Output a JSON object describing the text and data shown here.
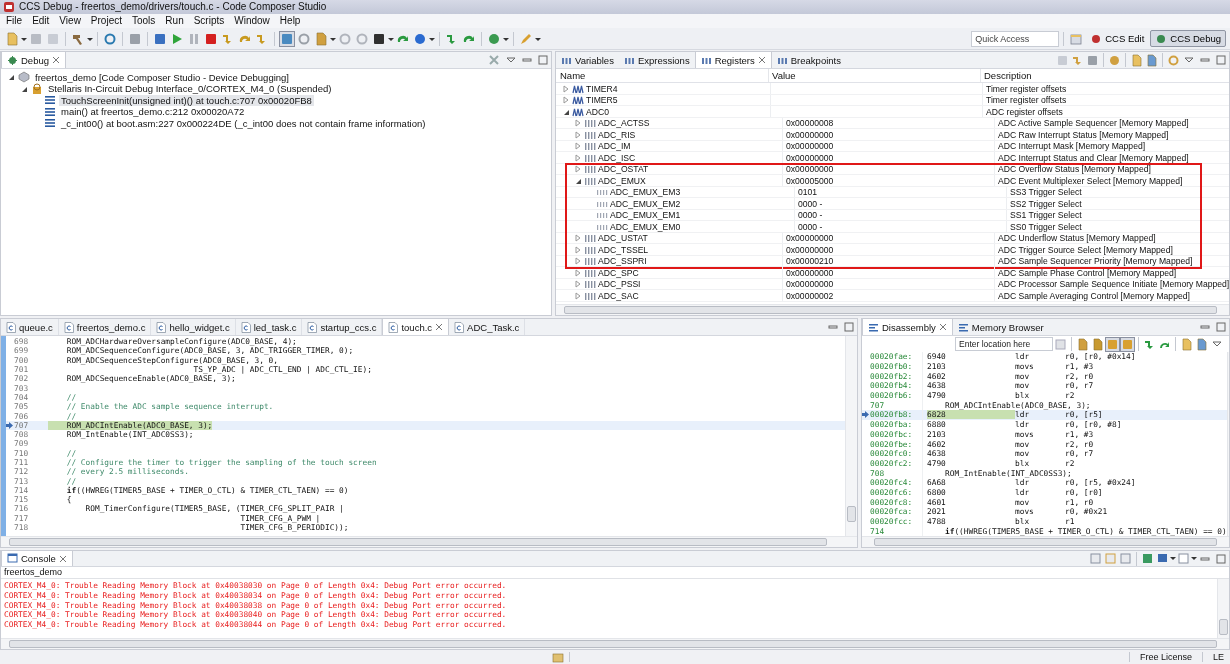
{
  "window": {
    "title": "CCS Debug - freertos_demo/drivers/touch.c - Code Composer Studio"
  },
  "menu": [
    "File",
    "Edit",
    "View",
    "Project",
    "Tools",
    "Run",
    "Scripts",
    "Window",
    "Help"
  ],
  "quick_access": {
    "placeholder": "Quick Access"
  },
  "perspectives": [
    {
      "label": "CCS Edit",
      "selected": false
    },
    {
      "label": "CCS Debug",
      "selected": true
    }
  ],
  "debug": {
    "tabs": [
      {
        "label": "Debug",
        "selected": true
      }
    ],
    "tree": [
      {
        "label": "freertos_demo [Code Composer Studio - Device Debugging]",
        "kind": "launch",
        "expanded": true,
        "children": [
          {
            "label": "Stellaris In-Circuit Debug Interface_0/CORTEX_M4_0 (Suspended)",
            "kind": "target",
            "expanded": true,
            "children": [
              {
                "label": "TouchScreenInit(unsigned int)() at touch.c:707 0x00020FB8",
                "kind": "frame",
                "selected": true
              },
              {
                "label": "main() at freertos_demo.c:212 0x00020A72",
                "kind": "frame",
                "selected": false
              },
              {
                "label": "_c_int00() at boot.asm:227 0x000224DE  (_c_int00 does not contain frame information)",
                "kind": "frame",
                "selected": false
              }
            ]
          }
        ]
      }
    ]
  },
  "registers": {
    "tabs": [
      {
        "label": "Variables",
        "selected": false
      },
      {
        "label": "Expressions",
        "selected": false
      },
      {
        "label": "Registers",
        "selected": true
      },
      {
        "label": "Breakpoints",
        "selected": false
      }
    ],
    "columns": [
      "Name",
      "Value",
      "Description"
    ],
    "rows": [
      {
        "name": "TIMER4",
        "kind": "group",
        "expanded": false,
        "value": "",
        "description": "Timer register offsets",
        "highlighted": false
      },
      {
        "name": "TIMER5",
        "kind": "group",
        "expanded": false,
        "value": "",
        "description": "Timer register offsets",
        "highlighted": false
      },
      {
        "name": "ADC0",
        "kind": "group",
        "expanded": true,
        "value": "",
        "description": "ADC register offsets",
        "highlighted": false,
        "children": [
          {
            "name": "ADC_ACTSS",
            "kind": "register",
            "expanded": false,
            "value": "0x00000008",
            "description": "ADC Active Sample Sequencer [Memory Mapped]",
            "highlighted": false
          },
          {
            "name": "ADC_RIS",
            "kind": "register",
            "expanded": false,
            "value": "0x00000000",
            "description": "ADC Raw Interrupt Status [Memory Mapped]",
            "highlighted": false
          },
          {
            "name": "ADC_IM",
            "kind": "register",
            "expanded": false,
            "value": "0x00000000",
            "description": "ADC Interrupt Mask [Memory Mapped]",
            "highlighted": false
          },
          {
            "name": "ADC_ISC",
            "kind": "register",
            "expanded": false,
            "value": "0x00000000",
            "description": "ADC Interrupt Status and Clear [Memory Mapped]",
            "highlighted": false
          },
          {
            "name": "ADC_OSTAT",
            "kind": "register",
            "expanded": false,
            "value": "0x00000000",
            "description": "ADC Overflow Status [Memory Mapped]",
            "highlighted": true
          },
          {
            "name": "ADC_EMUX",
            "kind": "register",
            "expanded": true,
            "value": "0x00005000",
            "description": "ADC Event Multiplexer Select [Memory Mapped]",
            "highlighted": true,
            "children": [
              {
                "name": "ADC_EMUX_EM3",
                "kind": "field",
                "value": "0101",
                "description": "SS3 Trigger Select",
                "highlighted": true
              },
              {
                "name": "ADC_EMUX_EM2",
                "kind": "field",
                "value": "0000 -",
                "description": "SS2 Trigger Select",
                "highlighted": true
              },
              {
                "name": "ADC_EMUX_EM1",
                "kind": "field",
                "value": "0000 -",
                "description": "SS1 Trigger Select",
                "highlighted": true
              },
              {
                "name": "ADC_EMUX_EM0",
                "kind": "field",
                "value": "0000 -",
                "description": "SS0 Trigger Select",
                "highlighted": true
              }
            ]
          },
          {
            "name": "ADC_USTAT",
            "kind": "register",
            "expanded": false,
            "value": "0x00000000",
            "description": "ADC Underflow Status [Memory Mapped]",
            "highlighted": true
          },
          {
            "name": "ADC_TSSEL",
            "kind": "register",
            "expanded": false,
            "value": "0x00000000",
            "description": "ADC Trigger Source Select [Memory Mapped]",
            "highlighted": true
          },
          {
            "name": "ADC_SSPRI",
            "kind": "register",
            "expanded": false,
            "value": "0x00000210",
            "description": "ADC Sample Sequencer Priority [Memory Mapped]",
            "highlighted": true
          },
          {
            "name": "ADC_SPC",
            "kind": "register",
            "expanded": false,
            "value": "0x00000000",
            "description": "ADC Sample Phase Control [Memory Mapped]",
            "highlighted": false
          },
          {
            "name": "ADC_PSSI",
            "kind": "register",
            "expanded": false,
            "value": "0x00000000",
            "description": "ADC Processor Sample Sequence Initiate [Memory Mapped]",
            "highlighted": false
          },
          {
            "name": "ADC_SAC",
            "kind": "register",
            "expanded": false,
            "value": "0x00000002",
            "description": "ADC Sample Averaging Control [Memory Mapped]",
            "highlighted": false
          }
        ]
      }
    ]
  },
  "editor": {
    "tabs": [
      {
        "label": "queue.c",
        "selected": false
      },
      {
        "label": "freertos_demo.c",
        "selected": false
      },
      {
        "label": "hello_widget.c",
        "selected": false
      },
      {
        "label": "led_task.c",
        "selected": false
      },
      {
        "label": "startup_ccs.c",
        "selected": false
      },
      {
        "label": "touch.c",
        "selected": true
      },
      {
        "label": "ADC_Task.c",
        "selected": false
      }
    ],
    "lines": [
      {
        "number": "698",
        "kind": "code",
        "current": false,
        "text": "    ROM_ADCHardwareOversampleConfigure(ADC0_BASE, 4);"
      },
      {
        "number": "699",
        "kind": "code",
        "current": false,
        "text": "    ROM_ADCSequenceConfigure(ADC0_BASE, 3, ADC_TRIGGER_TIMER, 0);"
      },
      {
        "number": "700",
        "kind": "code",
        "current": false,
        "text": "    ROM_ADCSequenceStepConfigure(ADC0_BASE, 3, 0,"
      },
      {
        "number": "701",
        "kind": "code",
        "current": false,
        "text": "                               TS_YP_ADC | ADC_CTL_END | ADC_CTL_IE);"
      },
      {
        "number": "702",
        "kind": "code",
        "current": false,
        "text": "    ROM_ADCSequenceEnable(ADC0_BASE, 3);"
      },
      {
        "number": "703",
        "kind": "code",
        "current": false
      },
      {
        "number": "704",
        "kind": "comment",
        "current": false,
        "text": "    //"
      },
      {
        "number": "705",
        "kind": "comment",
        "current": false,
        "text": "    // Enable the ADC sample sequence interrupt."
      },
      {
        "number": "706",
        "kind": "comment",
        "current": false,
        "text": "    //"
      },
      {
        "number": "707",
        "kind": "code",
        "current": true,
        "text": "    ROM_ADCIntEnable(ADC0_BASE, 3);"
      },
      {
        "number": "708",
        "kind": "code",
        "current": false,
        "text": "    ROM_IntEnable(INT_ADC0SS3);"
      },
      {
        "number": "709",
        "kind": "code",
        "current": false
      },
      {
        "number": "710",
        "kind": "comment",
        "current": false,
        "text": "    //"
      },
      {
        "number": "711",
        "kind": "comment",
        "current": false,
        "text": "    // Configure the timer to trigger the sampling of the touch screen"
      },
      {
        "number": "712",
        "kind": "comment",
        "current": false,
        "text": "    // every 2.5 milliseconds."
      },
      {
        "number": "713",
        "kind": "comment",
        "current": false,
        "text": "    //"
      },
      {
        "number": "714",
        "kind": "code",
        "current": false,
        "text": "    **if**((HWREG(TIMER5_BASE + TIMER_O_CTL) & TIMER_CTL_TAEN) == 0)"
      },
      {
        "number": "715",
        "kind": "code",
        "current": false,
        "text": "    {"
      },
      {
        "number": "716",
        "kind": "code",
        "current": false,
        "text": "        ROM_TimerConfigure(TIMER5_BASE, (TIMER_CFG_SPLIT_PAIR |"
      },
      {
        "number": "717",
        "kind": "code",
        "current": false,
        "text": "                                         TIMER_CFG_A_PWM |"
      },
      {
        "number": "718",
        "kind": "code",
        "current": false,
        "text": "                                         TIMER_CFG_B_PERIODIC));"
      }
    ]
  },
  "disassembly": {
    "tabs": [
      {
        "label": "Disassembly",
        "selected": true
      },
      {
        "label": "Memory Browser",
        "selected": false
      }
    ],
    "location": {
      "placeholder": "Enter location here"
    },
    "rows": [
      {
        "kind": "instruction",
        "current": false,
        "address": "00020fae:",
        "opcode": "6940",
        "mnemonic": "ldr",
        "operands": "r0, [r0, #0x14]"
      },
      {
        "kind": "instruction",
        "current": false,
        "address": "00020fb0:",
        "opcode": "2103",
        "mnemonic": "movs",
        "operands": "r1, #3"
      },
      {
        "kind": "instruction",
        "current": false,
        "address": "00020fb2:",
        "opcode": "4602",
        "mnemonic": "mov",
        "operands": "r2, r0"
      },
      {
        "kind": "instruction",
        "current": false,
        "address": "00020fb4:",
        "opcode": "4638",
        "mnemonic": "mov",
        "operands": "r0, r7"
      },
      {
        "kind": "instruction",
        "current": false,
        "address": "00020fb6:",
        "opcode": "4790",
        "mnemonic": "blx",
        "operands": "r2"
      },
      {
        "kind": "source",
        "current": false,
        "line": "707",
        "text": "ROM_ADCIntEnable(ADC0_BASE, 3);"
      },
      {
        "kind": "instruction",
        "current": true,
        "address": "00020fb8:",
        "opcode": "6828",
        "mnemonic": "ldr",
        "operands": "r0, [r5]"
      },
      {
        "kind": "instruction",
        "current": false,
        "address": "00020fba:",
        "opcode": "6880",
        "mnemonic": "ldr",
        "operands": "r0, [r0, #8]"
      },
      {
        "kind": "instruction",
        "current": false,
        "address": "00020fbc:",
        "opcode": "2103",
        "mnemonic": "movs",
        "operands": "r1, #3"
      },
      {
        "kind": "instruction",
        "current": false,
        "address": "00020fbe:",
        "opcode": "4602",
        "mnemonic": "mov",
        "operands": "r2, r0"
      },
      {
        "kind": "instruction",
        "current": false,
        "address": "00020fc0:",
        "opcode": "4638",
        "mnemonic": "mov",
        "operands": "r0, r7"
      },
      {
        "kind": "instruction",
        "current": false,
        "address": "00020fc2:",
        "opcode": "4790",
        "mnemonic": "blx",
        "operands": "r2"
      },
      {
        "kind": "source",
        "current": false,
        "line": "708",
        "text": "ROM_IntEnable(INT_ADC0SS3);"
      },
      {
        "kind": "instruction",
        "current": false,
        "address": "00020fc4:",
        "opcode": "6A68",
        "mnemonic": "ldr",
        "operands": "r0, [r5, #0x24]"
      },
      {
        "kind": "instruction",
        "current": false,
        "address": "00020fc6:",
        "opcode": "6800",
        "mnemonic": "ldr",
        "operands": "r0, [r0]"
      },
      {
        "kind": "instruction",
        "current": false,
        "address": "00020fc8:",
        "opcode": "4601",
        "mnemonic": "mov",
        "operands": "r1, r0"
      },
      {
        "kind": "instruction",
        "current": false,
        "address": "00020fca:",
        "opcode": "2021",
        "mnemonic": "movs",
        "operands": "r0, #0x21"
      },
      {
        "kind": "instruction",
        "current": false,
        "address": "00020fcc:",
        "opcode": "4788",
        "mnemonic": "blx",
        "operands": "r1"
      },
      {
        "kind": "source",
        "current": false,
        "line": "714",
        "text": "**if**((HWREG(TIMER5_BASE + TIMER_O_CTL) & TIMER_CTL_TAEN) == 0)"
      }
    ]
  },
  "console": {
    "tabs": [
      {
        "label": "Console",
        "selected": true
      }
    ],
    "process": "freertos_demo",
    "lines": [
      "CORTEX_M4_0: Trouble Reading Memory Block at 0x40038030 on Page 0 of Length 0x4: Debug Port error occurred.",
      "CORTEX_M4_0: Trouble Reading Memory Block at 0x40038034 on Page 0 of Length 0x4: Debug Port error occurred.",
      "CORTEX_M4_0: Trouble Reading Memory Block at 0x40038038 on Page 0 of Length 0x4: Debug Port error occurred.",
      "CORTEX_M4_0: Trouble Reading Memory Block at 0x40038040 on Page 0 of Length 0x4: Debug Port error occurred.",
      "CORTEX_M4_0: Trouble Reading Memory Block at 0x40038044 on Page 0 of Length 0x4: Debug Port error occurred."
    ]
  },
  "status_bar": {
    "items": [
      "Free License",
      "LE"
    ]
  }
}
